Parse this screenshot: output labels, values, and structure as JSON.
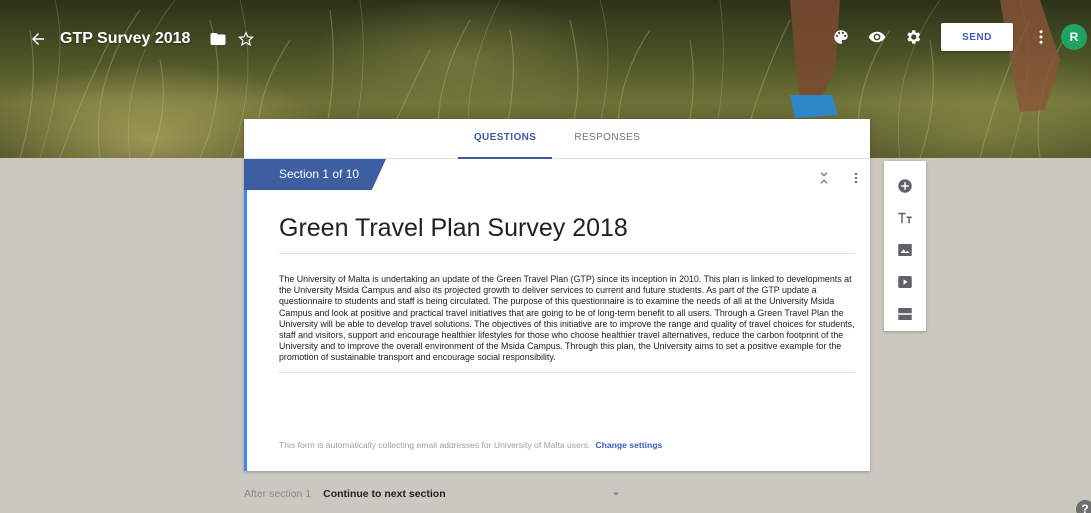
{
  "header": {
    "title": "GTP Survey 2018",
    "send_label": "SEND",
    "avatar_letter": "R",
    "icons": [
      "back-arrow-icon",
      "folder-icon",
      "star-outline-icon",
      "palette-icon",
      "eye-icon",
      "gear-icon",
      "more-vert-icon"
    ],
    "avatar_color": "#1ea362"
  },
  "tabs": [
    {
      "label": "QUESTIONS",
      "active": true
    },
    {
      "label": "RESPONSES",
      "active": false
    }
  ],
  "section": {
    "label": "Section 1 of 10",
    "color": "#3d5ea0"
  },
  "form": {
    "title": "Green Travel Plan Survey 2018",
    "description": "The University of Malta is undertaking an update of the Green Travel Plan (GTP) since its inception in 2010. This plan is linked to developments at the University Msida Campus and also its projected growth to deliver services to current and future students. As part of the GTP update a questionnaire to students and staff is being circulated. The purpose of this questionnaire is to examine the needs of all at the University Msida Campus and look at positive and practical travel initiatives that are going to be of long-term benefit to all users. Through a Green Travel Plan the University will be able to develop travel solutions. The objectives of this initiative are to improve the range and quality of travel choices for students, staff and visitors, support and encourage healthier lifestyles for those who choose healthier travel alternatives, reduce the carbon footprint of the University and to improve the overall environment of the Msida Campus. Through this plan, the University aims to set a positive example for the promotion of sustainable transport and encourage social responsibility.",
    "email_note": "This form is automatically collecting email addresses for University of Malta users.",
    "change_settings_label": "Change settings",
    "accent_color": "#4285f4"
  },
  "side_toolbar": {
    "tools": [
      "add-question-icon",
      "add-title-icon",
      "add-image-icon",
      "add-video-icon",
      "add-section-icon"
    ]
  },
  "after_section": {
    "label": "After section 1",
    "selected": "Continue to next section"
  },
  "help_label": "?"
}
